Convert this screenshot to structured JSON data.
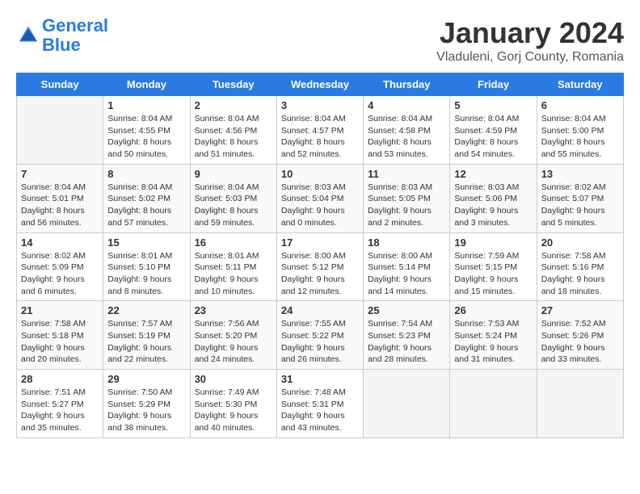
{
  "logo": {
    "line1": "General",
    "line2": "Blue"
  },
  "title": "January 2024",
  "subtitle": "Vladuleni, Gorj County, Romania",
  "days_of_week": [
    "Sunday",
    "Monday",
    "Tuesday",
    "Wednesday",
    "Thursday",
    "Friday",
    "Saturday"
  ],
  "weeks": [
    [
      {
        "num": "",
        "sunrise": "",
        "sunset": "",
        "daylight": ""
      },
      {
        "num": "1",
        "sunrise": "Sunrise: 8:04 AM",
        "sunset": "Sunset: 4:55 PM",
        "daylight": "Daylight: 8 hours and 50 minutes."
      },
      {
        "num": "2",
        "sunrise": "Sunrise: 8:04 AM",
        "sunset": "Sunset: 4:56 PM",
        "daylight": "Daylight: 8 hours and 51 minutes."
      },
      {
        "num": "3",
        "sunrise": "Sunrise: 8:04 AM",
        "sunset": "Sunset: 4:57 PM",
        "daylight": "Daylight: 8 hours and 52 minutes."
      },
      {
        "num": "4",
        "sunrise": "Sunrise: 8:04 AM",
        "sunset": "Sunset: 4:58 PM",
        "daylight": "Daylight: 8 hours and 53 minutes."
      },
      {
        "num": "5",
        "sunrise": "Sunrise: 8:04 AM",
        "sunset": "Sunset: 4:59 PM",
        "daylight": "Daylight: 8 hours and 54 minutes."
      },
      {
        "num": "6",
        "sunrise": "Sunrise: 8:04 AM",
        "sunset": "Sunset: 5:00 PM",
        "daylight": "Daylight: 8 hours and 55 minutes."
      }
    ],
    [
      {
        "num": "7",
        "sunrise": "Sunrise: 8:04 AM",
        "sunset": "Sunset: 5:01 PM",
        "daylight": "Daylight: 8 hours and 56 minutes."
      },
      {
        "num": "8",
        "sunrise": "Sunrise: 8:04 AM",
        "sunset": "Sunset: 5:02 PM",
        "daylight": "Daylight: 8 hours and 57 minutes."
      },
      {
        "num": "9",
        "sunrise": "Sunrise: 8:04 AM",
        "sunset": "Sunset: 5:03 PM",
        "daylight": "Daylight: 8 hours and 59 minutes."
      },
      {
        "num": "10",
        "sunrise": "Sunrise: 8:03 AM",
        "sunset": "Sunset: 5:04 PM",
        "daylight": "Daylight: 9 hours and 0 minutes."
      },
      {
        "num": "11",
        "sunrise": "Sunrise: 8:03 AM",
        "sunset": "Sunset: 5:05 PM",
        "daylight": "Daylight: 9 hours and 2 minutes."
      },
      {
        "num": "12",
        "sunrise": "Sunrise: 8:03 AM",
        "sunset": "Sunset: 5:06 PM",
        "daylight": "Daylight: 9 hours and 3 minutes."
      },
      {
        "num": "13",
        "sunrise": "Sunrise: 8:02 AM",
        "sunset": "Sunset: 5:07 PM",
        "daylight": "Daylight: 9 hours and 5 minutes."
      }
    ],
    [
      {
        "num": "14",
        "sunrise": "Sunrise: 8:02 AM",
        "sunset": "Sunset: 5:09 PM",
        "daylight": "Daylight: 9 hours and 6 minutes."
      },
      {
        "num": "15",
        "sunrise": "Sunrise: 8:01 AM",
        "sunset": "Sunset: 5:10 PM",
        "daylight": "Daylight: 9 hours and 8 minutes."
      },
      {
        "num": "16",
        "sunrise": "Sunrise: 8:01 AM",
        "sunset": "Sunset: 5:11 PM",
        "daylight": "Daylight: 9 hours and 10 minutes."
      },
      {
        "num": "17",
        "sunrise": "Sunrise: 8:00 AM",
        "sunset": "Sunset: 5:12 PM",
        "daylight": "Daylight: 9 hours and 12 minutes."
      },
      {
        "num": "18",
        "sunrise": "Sunrise: 8:00 AM",
        "sunset": "Sunset: 5:14 PM",
        "daylight": "Daylight: 9 hours and 14 minutes."
      },
      {
        "num": "19",
        "sunrise": "Sunrise: 7:59 AM",
        "sunset": "Sunset: 5:15 PM",
        "daylight": "Daylight: 9 hours and 15 minutes."
      },
      {
        "num": "20",
        "sunrise": "Sunrise: 7:58 AM",
        "sunset": "Sunset: 5:16 PM",
        "daylight": "Daylight: 9 hours and 18 minutes."
      }
    ],
    [
      {
        "num": "21",
        "sunrise": "Sunrise: 7:58 AM",
        "sunset": "Sunset: 5:18 PM",
        "daylight": "Daylight: 9 hours and 20 minutes."
      },
      {
        "num": "22",
        "sunrise": "Sunrise: 7:57 AM",
        "sunset": "Sunset: 5:19 PM",
        "daylight": "Daylight: 9 hours and 22 minutes."
      },
      {
        "num": "23",
        "sunrise": "Sunrise: 7:56 AM",
        "sunset": "Sunset: 5:20 PM",
        "daylight": "Daylight: 9 hours and 24 minutes."
      },
      {
        "num": "24",
        "sunrise": "Sunrise: 7:55 AM",
        "sunset": "Sunset: 5:22 PM",
        "daylight": "Daylight: 9 hours and 26 minutes."
      },
      {
        "num": "25",
        "sunrise": "Sunrise: 7:54 AM",
        "sunset": "Sunset: 5:23 PM",
        "daylight": "Daylight: 9 hours and 28 minutes."
      },
      {
        "num": "26",
        "sunrise": "Sunrise: 7:53 AM",
        "sunset": "Sunset: 5:24 PM",
        "daylight": "Daylight: 9 hours and 31 minutes."
      },
      {
        "num": "27",
        "sunrise": "Sunrise: 7:52 AM",
        "sunset": "Sunset: 5:26 PM",
        "daylight": "Daylight: 9 hours and 33 minutes."
      }
    ],
    [
      {
        "num": "28",
        "sunrise": "Sunrise: 7:51 AM",
        "sunset": "Sunset: 5:27 PM",
        "daylight": "Daylight: 9 hours and 35 minutes."
      },
      {
        "num": "29",
        "sunrise": "Sunrise: 7:50 AM",
        "sunset": "Sunset: 5:29 PM",
        "daylight": "Daylight: 9 hours and 38 minutes."
      },
      {
        "num": "30",
        "sunrise": "Sunrise: 7:49 AM",
        "sunset": "Sunset: 5:30 PM",
        "daylight": "Daylight: 9 hours and 40 minutes."
      },
      {
        "num": "31",
        "sunrise": "Sunrise: 7:48 AM",
        "sunset": "Sunset: 5:31 PM",
        "daylight": "Daylight: 9 hours and 43 minutes."
      },
      {
        "num": "",
        "sunrise": "",
        "sunset": "",
        "daylight": ""
      },
      {
        "num": "",
        "sunrise": "",
        "sunset": "",
        "daylight": ""
      },
      {
        "num": "",
        "sunrise": "",
        "sunset": "",
        "daylight": ""
      }
    ]
  ]
}
